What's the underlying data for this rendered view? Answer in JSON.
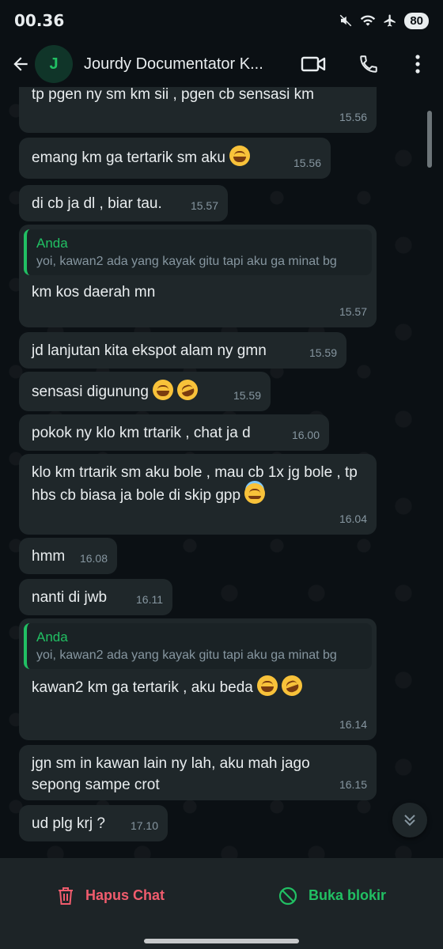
{
  "status_bar": {
    "time": "00.36",
    "battery": "80"
  },
  "app_bar": {
    "avatar_letter": "J",
    "contact_name": "Jourdy Documentator K..."
  },
  "messages": [
    {
      "text": "tp pgen ny sm km sii , pgen cb sensasi km",
      "time": "15.56"
    },
    {
      "text": "emang km ga tertarik sm aku",
      "time": "15.56"
    },
    {
      "text": "di cb ja dl , biar tau.",
      "time": "15.57"
    },
    {
      "quote_author": "Anda",
      "quote_text": "yoi, kawan2 ada yang kayak gitu tapi aku ga minat bg",
      "text": "km kos daerah mn",
      "time": "15.57"
    },
    {
      "text": "jd lanjutan kita ekspot alam ny gmn",
      "time": "15.59"
    },
    {
      "text": "sensasi digunung",
      "time": "15.59"
    },
    {
      "text": "pokok ny klo km trtarik , chat ja d",
      "time": "16.00"
    },
    {
      "text": "klo km trtarik sm aku bole , mau cb 1x jg bole , tp hbs cb biasa ja bole di skip gpp",
      "time": "16.04"
    },
    {
      "text": "hmm",
      "time": "16.08"
    },
    {
      "text": "nanti di jwb",
      "time": "16.11"
    },
    {
      "quote_author": "Anda",
      "quote_text": "yoi, kawan2 ada yang kayak gitu tapi aku ga minat bg",
      "text": "kawan2 km ga tertarik , aku beda",
      "time": "16.14"
    },
    {
      "text": "jgn sm in kawan lain ny lah, aku mah jago sepong sampe crot",
      "time": "16.15"
    },
    {
      "text": "ud plg krj ?",
      "time": "17.10"
    }
  ],
  "blocked_bar": {
    "delete_label": "Hapus Chat",
    "unblock_label": "Buka blokir"
  },
  "colors": {
    "accent": "#21c063",
    "danger": "#f15c6d",
    "bubble": "#1f272a",
    "background": "#0b1014"
  }
}
